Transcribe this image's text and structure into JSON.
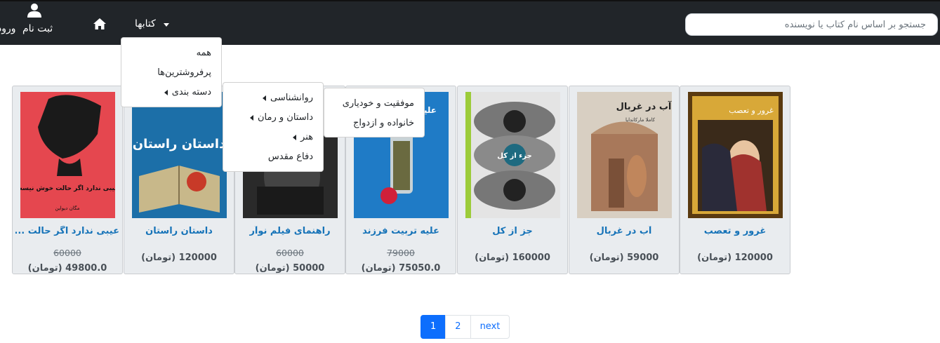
{
  "navbar": {
    "login_label": "ورود",
    "register_label": "ثبت نام",
    "books_menu_label": "کتابها",
    "search_placeholder": "جستجو بر اساس نام کتاب یا نویسنده"
  },
  "books_dropdown": {
    "items": [
      "همه",
      "پرفروشترین‌ها",
      "دسته بندی"
    ]
  },
  "category_submenu": {
    "items": [
      "روانشناسی",
      "داستان و رمان",
      "هنر",
      "دفاع مقدس"
    ]
  },
  "psychology_submenu": {
    "items": [
      "موفقیت و خودیاری",
      "خانواده و ازدواج"
    ]
  },
  "books": [
    {
      "title": "غرور و تعصب",
      "price": "120000 (تومان)",
      "old_price": null
    },
    {
      "title": "آب در غربال",
      "price": "59000 (تومان)",
      "old_price": null
    },
    {
      "title": "جز از کل",
      "price": "160000 (تومان)",
      "old_price": null
    },
    {
      "title": "علیه تربیت فرزند",
      "price": "75050.0 (تومان)",
      "old_price": "79000"
    },
    {
      "title": "راهنمای فیلم نوآر",
      "price": "50000 (تومان)",
      "old_price": "60000"
    },
    {
      "title": "داستان راستان",
      "price": "120000 (تومان)",
      "old_price": null
    },
    {
      "title": "عیبی ندارد اگر حالت ...",
      "price": "49800.0 (تومان)",
      "old_price": "60000"
    }
  ],
  "pagination": {
    "pages": [
      "1",
      "2"
    ],
    "next_label": "next",
    "current": "1"
  },
  "colors": {
    "navbar": "#212529",
    "link": "#1673b8",
    "active_page": "#0d6efd"
  }
}
